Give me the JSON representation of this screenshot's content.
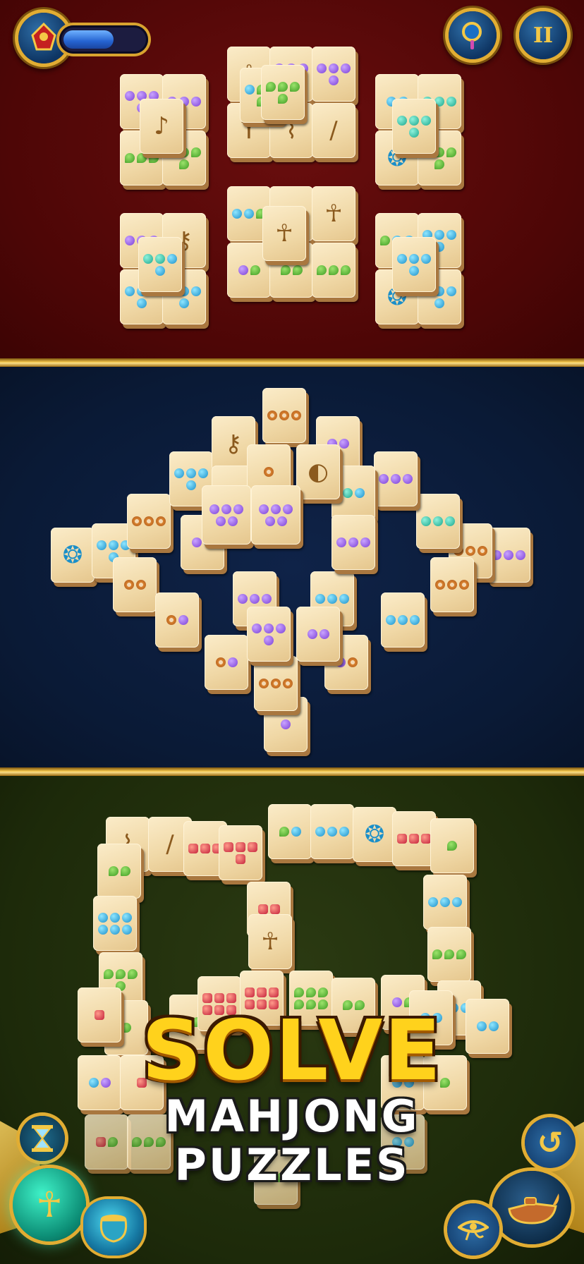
{
  "hud": {
    "energy_icon": "scarab-amulet-icon",
    "energy_level": 0.62,
    "hint_icon": "magnifier-icon",
    "pause_icon": "pause-icon",
    "pause_label": "II"
  },
  "headline": {
    "line1": "SOLVE",
    "line2": "MAHJONG",
    "line3": "PUZZLES"
  },
  "boosters": {
    "hourglass_icon": "hourglass-icon",
    "shuffle_icon": "ankh-dice-icon",
    "shuffle_glyph": "☥",
    "treasure_icon": "treasure-pot-icon",
    "undo_icon": "undo-arrow-icon",
    "undo_glyph": "↺",
    "eye_icon": "eye-of-horus-icon",
    "eye_glyph": "𓂀",
    "lamp_icon": "oil-lamp-icon"
  },
  "colors": {
    "board1_bg": "#4d0606",
    "board2_bg": "#0a1a36",
    "board3_bg": "#1d2a0a",
    "gold": "#f3c54a",
    "title_yellow": "#ffd21c"
  }
}
